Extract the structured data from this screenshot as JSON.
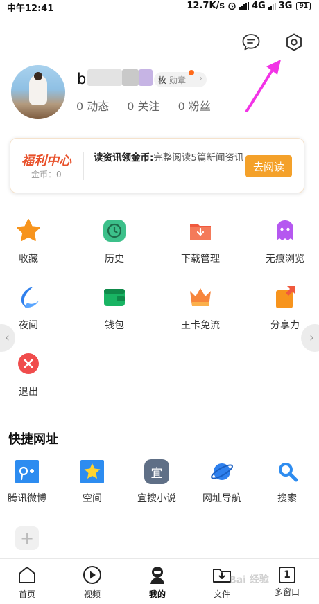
{
  "status_bar": {
    "time": "中午12:41",
    "net_speed": "12.7K/s",
    "network_1": "4G",
    "network_2": "3G",
    "battery": "91"
  },
  "profile": {
    "username": "b",
    "medal_count_unit": "枚",
    "medal_label": "勋章",
    "stats": [
      {
        "label": "0 动态"
      },
      {
        "label": "0 关注"
      },
      {
        "label": "0 粉丝"
      }
    ]
  },
  "welfare": {
    "title": "福利中心",
    "coins": "金币：0",
    "desc_strong": "读资讯领金币:",
    "desc": "完整阅读5篇新闻资讯",
    "button": "去阅读"
  },
  "functions": [
    {
      "label": "收藏",
      "icon": "star-icon",
      "color": "#f7941d"
    },
    {
      "label": "历史",
      "icon": "clock-icon",
      "color": "#3cc08a"
    },
    {
      "label": "下载管理",
      "icon": "download-folder-icon",
      "color": "#f0593e"
    },
    {
      "label": "无痕浏览",
      "icon": "ghost-icon",
      "color": "#b558f0"
    },
    {
      "label": "夜间",
      "icon": "moon-icon",
      "color": "#2f80ed"
    },
    {
      "label": "钱包",
      "icon": "wallet-icon",
      "color": "#19b463"
    },
    {
      "label": "王卡免流",
      "icon": "crown-icon",
      "color": "#f7853b"
    },
    {
      "label": "分享力",
      "icon": "share-icon",
      "color": "#f7941d"
    },
    {
      "label": "退出",
      "icon": "exit-icon",
      "color": "#f04c4c"
    }
  ],
  "quick_sites": {
    "title": "快捷网址",
    "items": [
      {
        "label": "腾讯微博",
        "icon": "weibo-icon"
      },
      {
        "label": "空间",
        "icon": "qzone-icon"
      },
      {
        "label": "宜搜小说",
        "icon": "yisou-icon",
        "glyph": "宜"
      },
      {
        "label": "网址导航",
        "icon": "planet-icon"
      },
      {
        "label": "搜索",
        "icon": "search-icon"
      }
    ]
  },
  "bottom_nav": [
    {
      "label": "首页",
      "icon": "home-icon"
    },
    {
      "label": "视频",
      "icon": "play-icon"
    },
    {
      "label": "我的",
      "icon": "user-icon"
    },
    {
      "label": "文件",
      "icon": "file-download-icon"
    },
    {
      "label": "多窗口",
      "icon": "window-count-icon",
      "count": "1"
    }
  ],
  "watermark": "Bai 经验"
}
